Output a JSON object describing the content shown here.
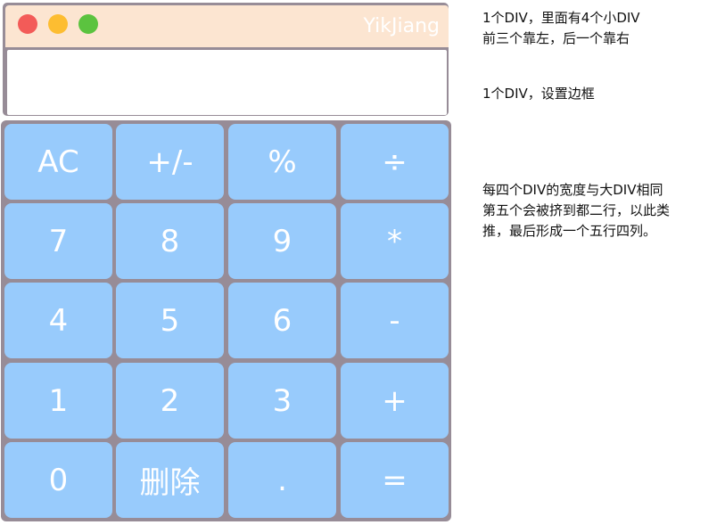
{
  "window": {
    "brand": "YikJiang",
    "display_value": ""
  },
  "keypad": {
    "rows": [
      [
        "AC",
        "+/-",
        "%",
        "÷"
      ],
      [
        "7",
        "8",
        "9",
        "*"
      ],
      [
        "4",
        "5",
        "6",
        "-"
      ],
      [
        "1",
        "2",
        "3",
        "+"
      ],
      [
        "0",
        "删除",
        ".",
        "="
      ]
    ]
  },
  "notes": {
    "titlebar": [
      "1个DIV，里面有4个小DIV",
      "前三个靠左，后一个靠右"
    ],
    "display": [
      "1个DIV，设置边框"
    ],
    "keypad": [
      "每四个DIV的宽度与大DIV相同",
      "第五个会被挤到都二行，以此类",
      "推，最后形成一个五行四列。"
    ]
  },
  "colors": {
    "titlebar_bg": "#fce5d1",
    "frame": "#978c97",
    "key_bg": "#98cbfc",
    "close": "#f35b58",
    "minimize": "#fdbd31",
    "maximize": "#5bc33f"
  }
}
